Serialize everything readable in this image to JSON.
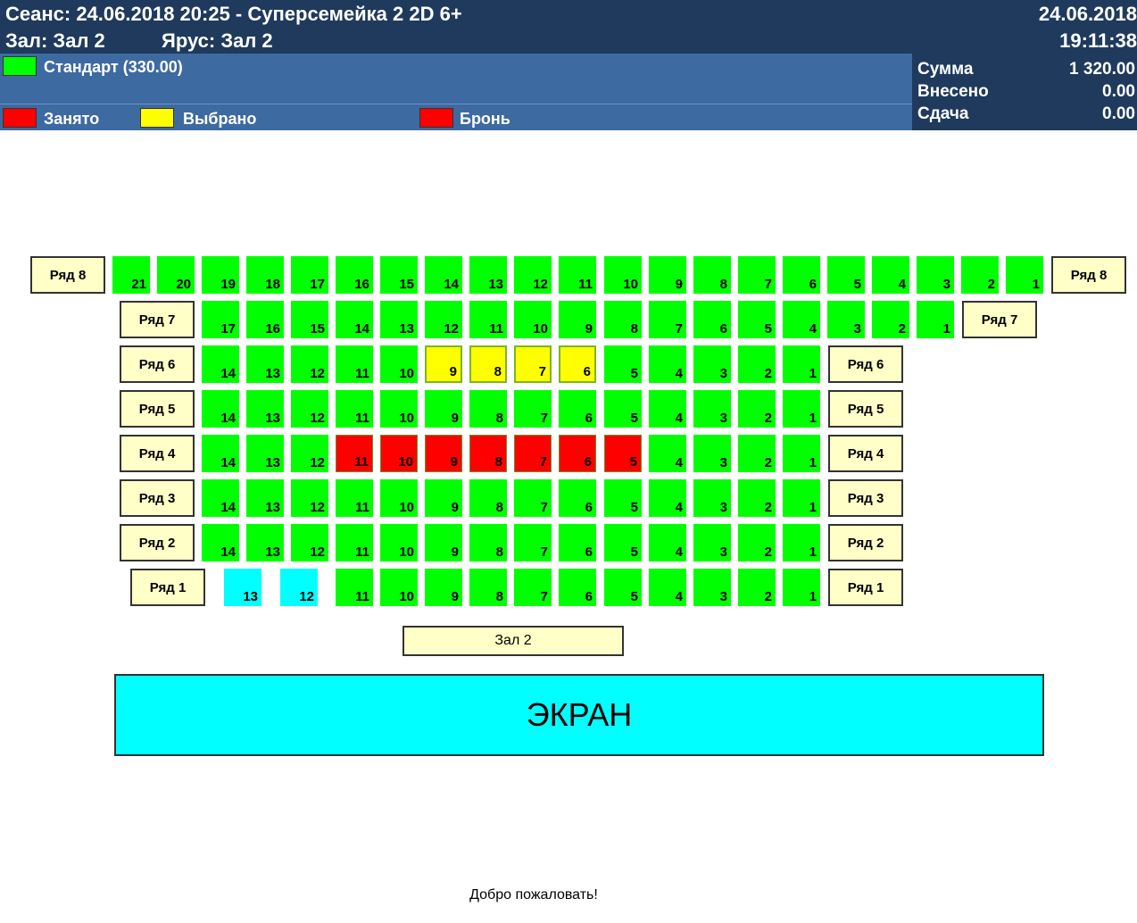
{
  "header": {
    "session": "Сеанс: 24.06.2018 20:25 - Суперсемейка 2 2D 6+",
    "date": "24.06.2018",
    "hall": "Зал: Зал 2",
    "tier": "Ярус: Зал 2",
    "time": "19:11:38"
  },
  "legend": {
    "standard": "Стандарт (330.00)",
    "taken": "Занято",
    "selected": "Выбрано",
    "reserved": "Бронь",
    "colors": {
      "standard": "#00ff00",
      "taken": "#ff0000",
      "selected": "#ffff00",
      "reserved": "#ff0000"
    }
  },
  "totals": {
    "sum_label": "Сумма",
    "sum_value": "1 320.00",
    "paid_label": "Внесено",
    "paid_value": "0.00",
    "change_label": "Сдача",
    "change_value": "0.00"
  },
  "rows": [
    {
      "label": "Ряд 8",
      "seats": [
        {
          "n": "21",
          "s": "free"
        },
        {
          "n": "20",
          "s": "free"
        },
        {
          "n": "19",
          "s": "free"
        },
        {
          "n": "18",
          "s": "free"
        },
        {
          "n": "17",
          "s": "free"
        },
        {
          "n": "16",
          "s": "free"
        },
        {
          "n": "15",
          "s": "free"
        },
        {
          "n": "14",
          "s": "free"
        },
        {
          "n": "13",
          "s": "free"
        },
        {
          "n": "12",
          "s": "free"
        },
        {
          "n": "11",
          "s": "free"
        },
        {
          "n": "10",
          "s": "free"
        },
        {
          "n": "9",
          "s": "free"
        },
        {
          "n": "8",
          "s": "free"
        },
        {
          "n": "7",
          "s": "free"
        },
        {
          "n": "6",
          "s": "free"
        },
        {
          "n": "5",
          "s": "free"
        },
        {
          "n": "4",
          "s": "free"
        },
        {
          "n": "3",
          "s": "free"
        },
        {
          "n": "2",
          "s": "free"
        },
        {
          "n": "1",
          "s": "free"
        }
      ]
    },
    {
      "label": "Ряд 7",
      "seats": [
        {
          "n": "17",
          "s": "free"
        },
        {
          "n": "16",
          "s": "free"
        },
        {
          "n": "15",
          "s": "free"
        },
        {
          "n": "14",
          "s": "free"
        },
        {
          "n": "13",
          "s": "free"
        },
        {
          "n": "12",
          "s": "free"
        },
        {
          "n": "11",
          "s": "free"
        },
        {
          "n": "10",
          "s": "free"
        },
        {
          "n": "9",
          "s": "free"
        },
        {
          "n": "8",
          "s": "free"
        },
        {
          "n": "7",
          "s": "free"
        },
        {
          "n": "6",
          "s": "free"
        },
        {
          "n": "5",
          "s": "free"
        },
        {
          "n": "4",
          "s": "free"
        },
        {
          "n": "3",
          "s": "free"
        },
        {
          "n": "2",
          "s": "free"
        },
        {
          "n": "1",
          "s": "free"
        }
      ]
    },
    {
      "label": "Ряд 6",
      "seats": [
        {
          "n": "14",
          "s": "free"
        },
        {
          "n": "13",
          "s": "free"
        },
        {
          "n": "12",
          "s": "free"
        },
        {
          "n": "11",
          "s": "free"
        },
        {
          "n": "10",
          "s": "free"
        },
        {
          "n": "9",
          "s": "selected"
        },
        {
          "n": "8",
          "s": "selected"
        },
        {
          "n": "7",
          "s": "selected"
        },
        {
          "n": "6",
          "s": "selected"
        },
        {
          "n": "5",
          "s": "free"
        },
        {
          "n": "4",
          "s": "free"
        },
        {
          "n": "3",
          "s": "free"
        },
        {
          "n": "2",
          "s": "free"
        },
        {
          "n": "1",
          "s": "free"
        }
      ]
    },
    {
      "label": "Ряд 5",
      "seats": [
        {
          "n": "14",
          "s": "free"
        },
        {
          "n": "13",
          "s": "free"
        },
        {
          "n": "12",
          "s": "free"
        },
        {
          "n": "11",
          "s": "free"
        },
        {
          "n": "10",
          "s": "free"
        },
        {
          "n": "9",
          "s": "free"
        },
        {
          "n": "8",
          "s": "free"
        },
        {
          "n": "7",
          "s": "free"
        },
        {
          "n": "6",
          "s": "free"
        },
        {
          "n": "5",
          "s": "free"
        },
        {
          "n": "4",
          "s": "free"
        },
        {
          "n": "3",
          "s": "free"
        },
        {
          "n": "2",
          "s": "free"
        },
        {
          "n": "1",
          "s": "free"
        }
      ]
    },
    {
      "label": "Ряд 4",
      "seats": [
        {
          "n": "14",
          "s": "free"
        },
        {
          "n": "13",
          "s": "free"
        },
        {
          "n": "12",
          "s": "free"
        },
        {
          "n": "11",
          "s": "taken"
        },
        {
          "n": "10",
          "s": "taken"
        },
        {
          "n": "9",
          "s": "taken"
        },
        {
          "n": "8",
          "s": "taken"
        },
        {
          "n": "7",
          "s": "taken"
        },
        {
          "n": "6",
          "s": "taken"
        },
        {
          "n": "5",
          "s": "taken"
        },
        {
          "n": "4",
          "s": "free"
        },
        {
          "n": "3",
          "s": "free"
        },
        {
          "n": "2",
          "s": "free"
        },
        {
          "n": "1",
          "s": "free"
        }
      ]
    },
    {
      "label": "Ряд 3",
      "seats": [
        {
          "n": "14",
          "s": "free"
        },
        {
          "n": "13",
          "s": "free"
        },
        {
          "n": "12",
          "s": "free"
        },
        {
          "n": "11",
          "s": "free"
        },
        {
          "n": "10",
          "s": "free"
        },
        {
          "n": "9",
          "s": "free"
        },
        {
          "n": "8",
          "s": "free"
        },
        {
          "n": "7",
          "s": "free"
        },
        {
          "n": "6",
          "s": "free"
        },
        {
          "n": "5",
          "s": "free"
        },
        {
          "n": "4",
          "s": "free"
        },
        {
          "n": "3",
          "s": "free"
        },
        {
          "n": "2",
          "s": "free"
        },
        {
          "n": "1",
          "s": "free"
        }
      ]
    },
    {
      "label": "Ряд 2",
      "seats": [
        {
          "n": "14",
          "s": "free"
        },
        {
          "n": "13",
          "s": "free"
        },
        {
          "n": "12",
          "s": "free"
        },
        {
          "n": "11",
          "s": "free"
        },
        {
          "n": "10",
          "s": "free"
        },
        {
          "n": "9",
          "s": "free"
        },
        {
          "n": "8",
          "s": "free"
        },
        {
          "n": "7",
          "s": "free"
        },
        {
          "n": "6",
          "s": "free"
        },
        {
          "n": "5",
          "s": "free"
        },
        {
          "n": "4",
          "s": "free"
        },
        {
          "n": "3",
          "s": "free"
        },
        {
          "n": "2",
          "s": "free"
        },
        {
          "n": "1",
          "s": "free"
        }
      ]
    },
    {
      "label": "Ряд 1",
      "seats": [
        {
          "n": "13",
          "s": "cyan"
        },
        {
          "n": "12",
          "s": "cyan"
        },
        {
          "n": "11",
          "s": "free"
        },
        {
          "n": "10",
          "s": "free"
        },
        {
          "n": "9",
          "s": "free"
        },
        {
          "n": "8",
          "s": "free"
        },
        {
          "n": "7",
          "s": "free"
        },
        {
          "n": "6",
          "s": "free"
        },
        {
          "n": "5",
          "s": "free"
        },
        {
          "n": "4",
          "s": "free"
        },
        {
          "n": "3",
          "s": "free"
        },
        {
          "n": "2",
          "s": "free"
        },
        {
          "n": "1",
          "s": "free"
        }
      ]
    }
  ],
  "hall_name": "Зал 2",
  "screen_label": "ЭКРАН",
  "welcome": "Добро пожаловать!"
}
